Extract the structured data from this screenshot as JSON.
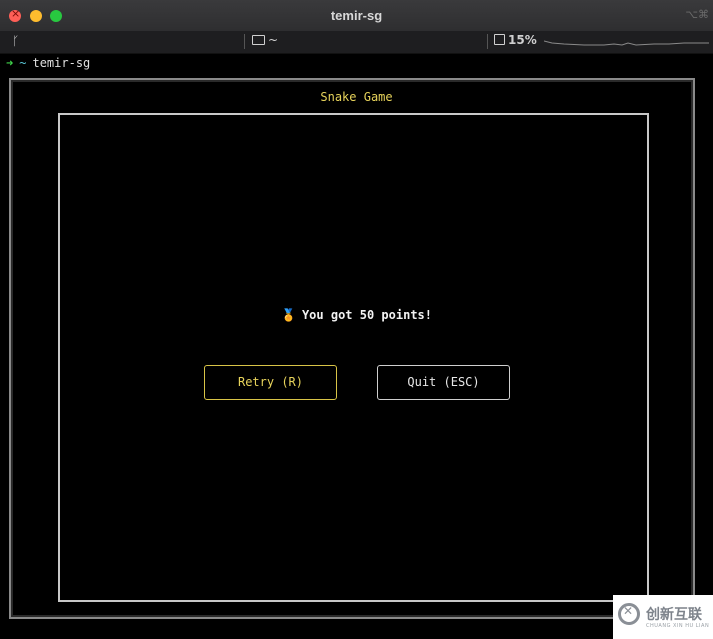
{
  "window": {
    "title": "temir-sg",
    "corner_glyph": "⌥⌘"
  },
  "statusbar": {
    "branch_glyph": "ᚴ",
    "folder_label": "~",
    "cpu_label": "15%"
  },
  "prompt": {
    "arrow": "➜",
    "tilde": "~",
    "directory": "temir-sg"
  },
  "game": {
    "title": "Snake Game",
    "medal_icon": "medal-icon",
    "medal_glyph": "🏅",
    "message": "You got 50 points!",
    "retry_label": "Retry (R)",
    "quit_label": "Quit (ESC)"
  },
  "watermark": {
    "text": "创新互联",
    "sub": "CHUANG XIN HU LIAN"
  },
  "colors": {
    "accent_yellow": "#e7d35b",
    "prompt_green": "#3fd14a",
    "frame_gray": "#c8c8c8",
    "terminal_bg": "#000000"
  }
}
